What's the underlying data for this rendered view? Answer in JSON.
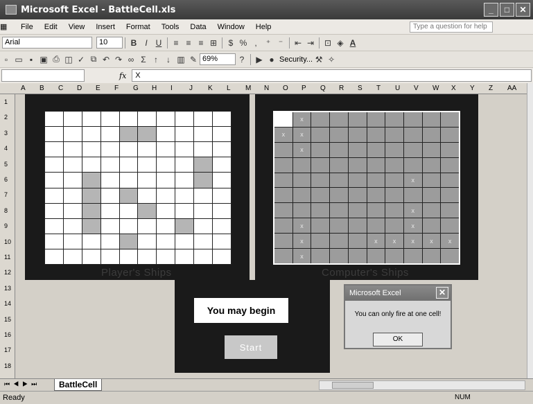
{
  "window": {
    "title": "Microsoft Excel - BattleCell.xls"
  },
  "menu": [
    "File",
    "Edit",
    "View",
    "Insert",
    "Format",
    "Tools",
    "Data",
    "Window",
    "Help"
  ],
  "help_placeholder": "Type a question for help",
  "font": {
    "name": "Arial",
    "size": "10"
  },
  "zoom": "69%",
  "security_label": "Security...",
  "formula": {
    "fx": "fx",
    "value": "X"
  },
  "columns": [
    "A",
    "B",
    "C",
    "D",
    "E",
    "F",
    "G",
    "H",
    "I",
    "J",
    "K",
    "L",
    "M",
    "N",
    "O",
    "P",
    "Q",
    "R",
    "S",
    "T",
    "U",
    "V",
    "W",
    "X",
    "Y",
    "Z",
    "AA"
  ],
  "rows": [
    "1",
    "2",
    "3",
    "4",
    "5",
    "6",
    "7",
    "8",
    "9",
    "10",
    "11",
    "12",
    "13",
    "14",
    "15",
    "16",
    "17",
    "18"
  ],
  "player_label": "Player's Ships",
  "computer_label": "Computer's Ships",
  "message": "You may begin",
  "start_label": "Start",
  "dialog": {
    "title": "Microsoft Excel",
    "message": "You can only fire at one cell!",
    "ok": "OK"
  },
  "sheet_tab": "BattleCell",
  "status": {
    "ready": "Ready",
    "num": "NUM"
  },
  "player_ships": [
    [
      1,
      4
    ],
    [
      1,
      5
    ],
    [
      4,
      2
    ],
    [
      5,
      2
    ],
    [
      5,
      4
    ],
    [
      6,
      2
    ],
    [
      6,
      5
    ],
    [
      7,
      2
    ],
    [
      8,
      4
    ],
    [
      7,
      7
    ],
    [
      3,
      8
    ],
    [
      4,
      8
    ]
  ],
  "computer_marks": [
    [
      0,
      1
    ],
    [
      1,
      0
    ],
    [
      1,
      1
    ],
    [
      2,
      1
    ],
    [
      4,
      7
    ],
    [
      6,
      7
    ],
    [
      7,
      1
    ],
    [
      7,
      7
    ],
    [
      8,
      1
    ],
    [
      8,
      5
    ],
    [
      8,
      6
    ],
    [
      8,
      7
    ],
    [
      8,
      8
    ],
    [
      8,
      9
    ],
    [
      9,
      1
    ]
  ],
  "computer_white": [
    [
      0,
      0
    ]
  ],
  "mark_char": "x"
}
